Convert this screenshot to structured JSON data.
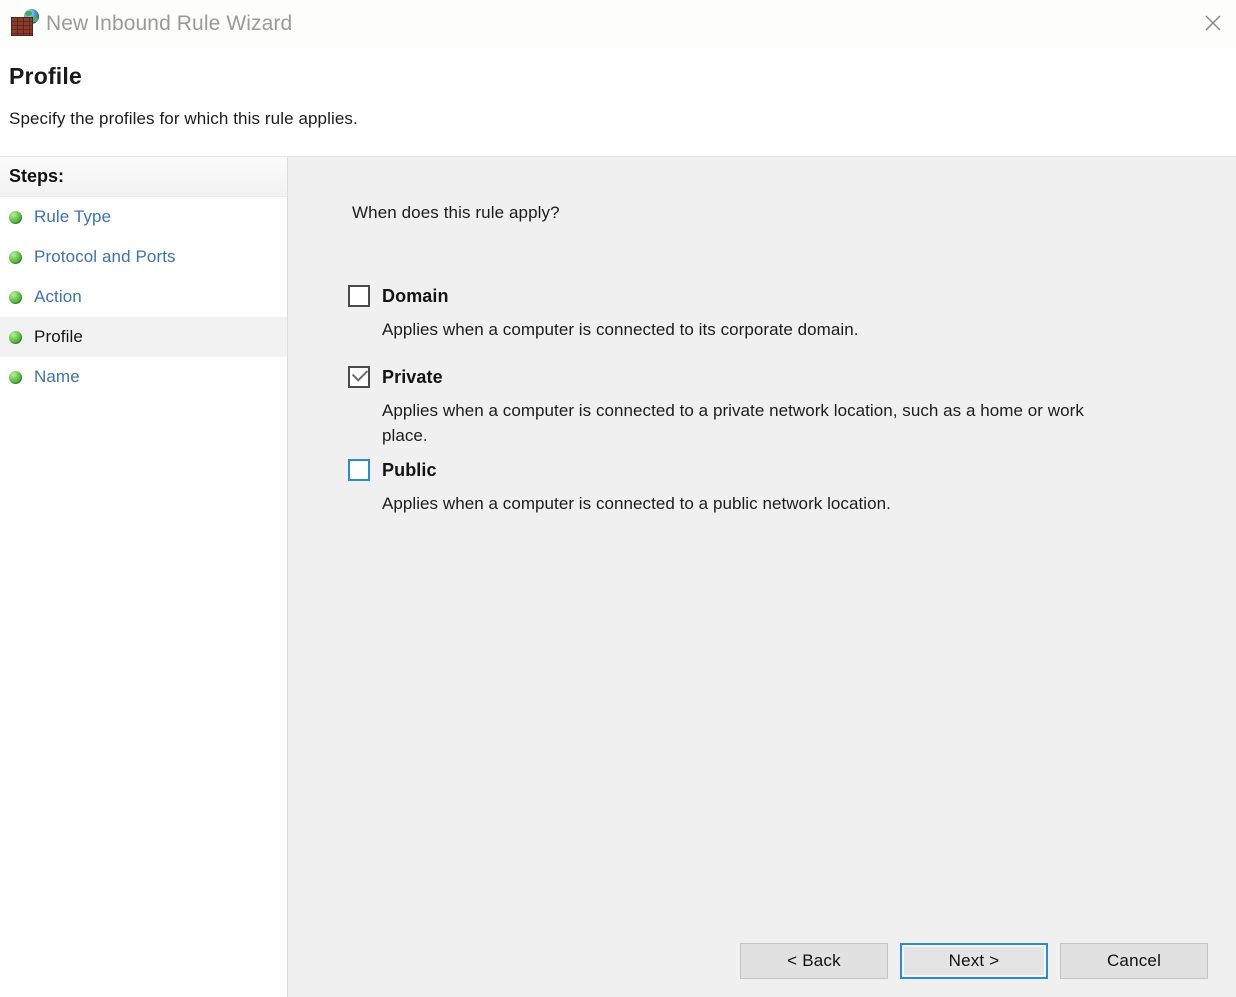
{
  "window": {
    "title": "New Inbound Rule Wizard",
    "app_icon": "firewall-globe-icon",
    "close_icon": "close-icon"
  },
  "header": {
    "title": "Profile",
    "subtitle": "Specify the profiles for which this rule applies."
  },
  "sidebar": {
    "header": "Steps:",
    "items": [
      {
        "label": "Rule Type",
        "active": false
      },
      {
        "label": "Protocol and Ports",
        "active": false
      },
      {
        "label": "Action",
        "active": false
      },
      {
        "label": "Profile",
        "active": true
      },
      {
        "label": "Name",
        "active": false
      }
    ]
  },
  "main": {
    "question": "When does this rule apply?",
    "options": [
      {
        "label": "Domain",
        "checked": false,
        "focused": false,
        "description": "Applies when a computer is connected to its corporate domain."
      },
      {
        "label": "Private",
        "checked": true,
        "focused": false,
        "description": "Applies when a computer is connected to a private network location, such as a home or work place."
      },
      {
        "label": "Public",
        "checked": false,
        "focused": true,
        "description": "Applies when a computer is connected to a public network location."
      }
    ]
  },
  "footer": {
    "back_label": "< Back",
    "next_label": "Next >",
    "cancel_label": "Cancel"
  },
  "colors": {
    "link": "#3f72b0",
    "focus": "#2d8ad1",
    "panel_bg": "#f0f0f0",
    "bullet_green": "#6ec94f",
    "title_text": "#9a9a9a"
  }
}
